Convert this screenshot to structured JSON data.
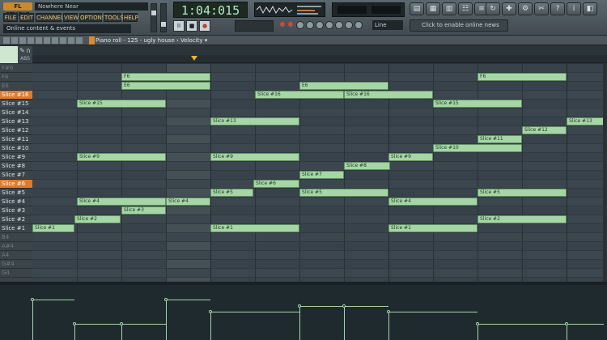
{
  "app": {
    "logo": "FL STUDIO",
    "song_title": "Nowhere Near",
    "hint": "Online content & events"
  },
  "menu": [
    {
      "label": "FILE",
      "w": 18
    },
    {
      "label": "EDIT",
      "w": 18
    },
    {
      "label": "CHANNELS",
      "w": 32
    },
    {
      "label": "VIEW",
      "w": 18
    },
    {
      "label": "OPTIONS",
      "w": 28
    },
    {
      "label": "TOOLS",
      "w": 22
    },
    {
      "label": "HELP",
      "w": 18
    }
  ],
  "transport": {
    "time": "1:04:015",
    "pause": "II",
    "stop": "■",
    "record": "●"
  },
  "toolbar": {
    "line_mode": "Line",
    "news": "Click to enable online news"
  },
  "piano_roll": {
    "title": "Piano roll - 125 - ugly house",
    "target": "Velocity",
    "abs": "ABS"
  },
  "keys": [
    {
      "label": "F#6",
      "dim": true
    },
    {
      "label": "F6",
      "dim": true
    },
    {
      "label": "E6",
      "dim": true
    },
    {
      "label": "Slice #16",
      "hl": true
    },
    {
      "label": "Slice #15"
    },
    {
      "label": "Slice #14"
    },
    {
      "label": "Slice #13"
    },
    {
      "label": "Slice #12"
    },
    {
      "label": "Slice #11"
    },
    {
      "label": "Slice #10"
    },
    {
      "label": "Slice #9"
    },
    {
      "label": "Slice #8"
    },
    {
      "label": "Slice #7"
    },
    {
      "label": "Slice #6",
      "hl": true
    },
    {
      "label": "Slice #5"
    },
    {
      "label": "Slice #4"
    },
    {
      "label": "Slice #3"
    },
    {
      "label": "Slice #2"
    },
    {
      "label": "Slice #1"
    },
    {
      "label": "B4",
      "dim": true
    },
    {
      "label": "A#4",
      "dim": true
    },
    {
      "label": "A4",
      "dim": true
    },
    {
      "label": "G#4",
      "dim": true
    },
    {
      "label": "G4",
      "dim": true
    }
  ],
  "notes": [
    {
      "label": "Slice #1",
      "row": 18,
      "start": 0,
      "len": 52
    },
    {
      "label": "Slice #2",
      "row": 17,
      "start": 52,
      "len": 57
    },
    {
      "label": "Slice #3",
      "row": 16,
      "start": 110,
      "len": 55
    },
    {
      "label": "Slice #4",
      "row": 15,
      "start": 55,
      "len": 110
    },
    {
      "label": "Slice #4",
      "row": 15,
      "start": 165,
      "len": 55
    },
    {
      "label": "Slice #9",
      "row": 10,
      "start": 55,
      "len": 110
    },
    {
      "label": "Slice #15",
      "row": 4,
      "start": 55,
      "len": 110
    },
    {
      "label": "F6",
      "row": 1,
      "start": 110,
      "len": 110
    },
    {
      "label": "E6",
      "row": 2,
      "start": 110,
      "len": 110
    },
    {
      "label": "Slice #13",
      "row": 6,
      "start": 220,
      "len": 110
    },
    {
      "label": "Slice #9",
      "row": 10,
      "start": 220,
      "len": 110
    },
    {
      "label": "Slice #5",
      "row": 14,
      "start": 220,
      "len": 53
    },
    {
      "label": "Slice #1",
      "row": 18,
      "start": 220,
      "len": 110
    },
    {
      "label": "Slice #6",
      "row": 13,
      "start": 273,
      "len": 57
    },
    {
      "label": "Slice #16",
      "row": 3,
      "start": 275,
      "len": 110
    },
    {
      "label": "E6",
      "row": 2,
      "start": 330,
      "len": 110
    },
    {
      "label": "Slice #7",
      "row": 12,
      "start": 330,
      "len": 55
    },
    {
      "label": "Slice #5",
      "row": 14,
      "start": 330,
      "len": 110
    },
    {
      "label": "Slice #16",
      "row": 3,
      "start": 385,
      "len": 110
    },
    {
      "label": "Slice #8",
      "row": 11,
      "start": 385,
      "len": 57
    },
    {
      "label": "Slice #9",
      "row": 10,
      "start": 440,
      "len": 55
    },
    {
      "label": "Slice #4",
      "row": 15,
      "start": 440,
      "len": 110
    },
    {
      "label": "Slice #1",
      "row": 18,
      "start": 440,
      "len": 110
    },
    {
      "label": "Slice #10",
      "row": 9,
      "start": 495,
      "len": 110
    },
    {
      "label": "Slice #15",
      "row": 4,
      "start": 495,
      "len": 110
    },
    {
      "label": "F6",
      "row": 1,
      "start": 550,
      "len": 110
    },
    {
      "label": "Slice #11",
      "row": 8,
      "start": 550,
      "len": 55
    },
    {
      "label": "Slice #5",
      "row": 14,
      "start": 550,
      "len": 110
    },
    {
      "label": "Slice #2",
      "row": 17,
      "start": 550,
      "len": 110
    },
    {
      "label": "Slice #12",
      "row": 7,
      "start": 605,
      "len": 55
    },
    {
      "label": "Slice #13",
      "row": 6,
      "start": 660,
      "len": 46
    }
  ],
  "velocity": [
    {
      "start": 0,
      "len": 52,
      "level": 0.74
    },
    {
      "start": 52,
      "len": 57,
      "level": 0.3
    },
    {
      "start": 110,
      "len": 55,
      "level": 0.3
    },
    {
      "start": 165,
      "len": 55,
      "level": 0.74
    },
    {
      "start": 220,
      "len": 110,
      "level": 0.52
    },
    {
      "start": 330,
      "len": 55,
      "level": 0.62
    },
    {
      "start": 385,
      "len": 55,
      "level": 0.62
    },
    {
      "start": 440,
      "len": 110,
      "level": 0.52
    },
    {
      "start": 550,
      "len": 110,
      "level": 0.3
    },
    {
      "start": 660,
      "len": 46,
      "level": 0.3
    }
  ]
}
